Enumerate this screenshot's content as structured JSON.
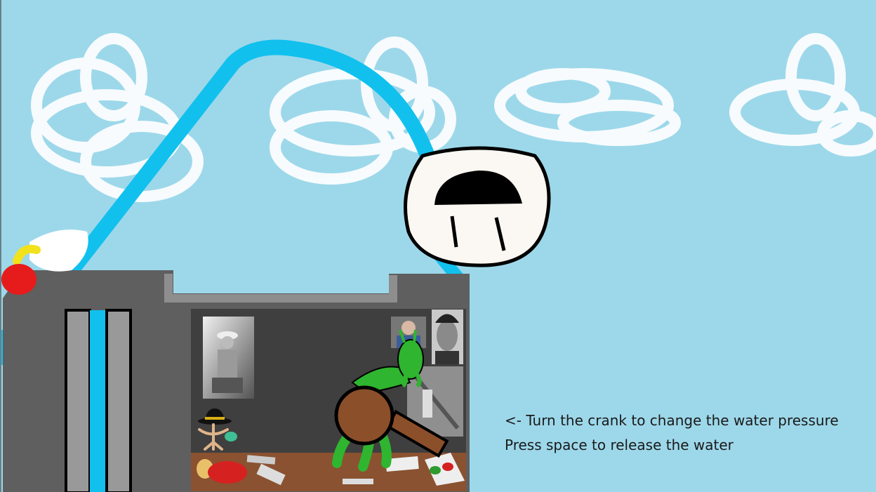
{
  "instructions": {
    "line1": "<- Turn the crank to change the water pressure",
    "line2": "Press space to release the water"
  },
  "colors": {
    "sky": "#9dd8ea",
    "cloud": "#ffffff",
    "water_pipe": "#12c0ee",
    "machine": "#5f5f5f",
    "room_wall": "#3f3f3f",
    "floor": "#8a5230",
    "crank_knob": "#e61b1b",
    "alien": "#2fb52f",
    "magnifier": "#8b4f2a",
    "shower_head": "#fbf7f2"
  },
  "icons": {
    "shower": "shower-head-icon",
    "crank": "crank-knob-icon",
    "hat": "fedora-hat-icon",
    "magnifier": "magnifying-glass-icon",
    "alien": "alien-character-icon"
  }
}
